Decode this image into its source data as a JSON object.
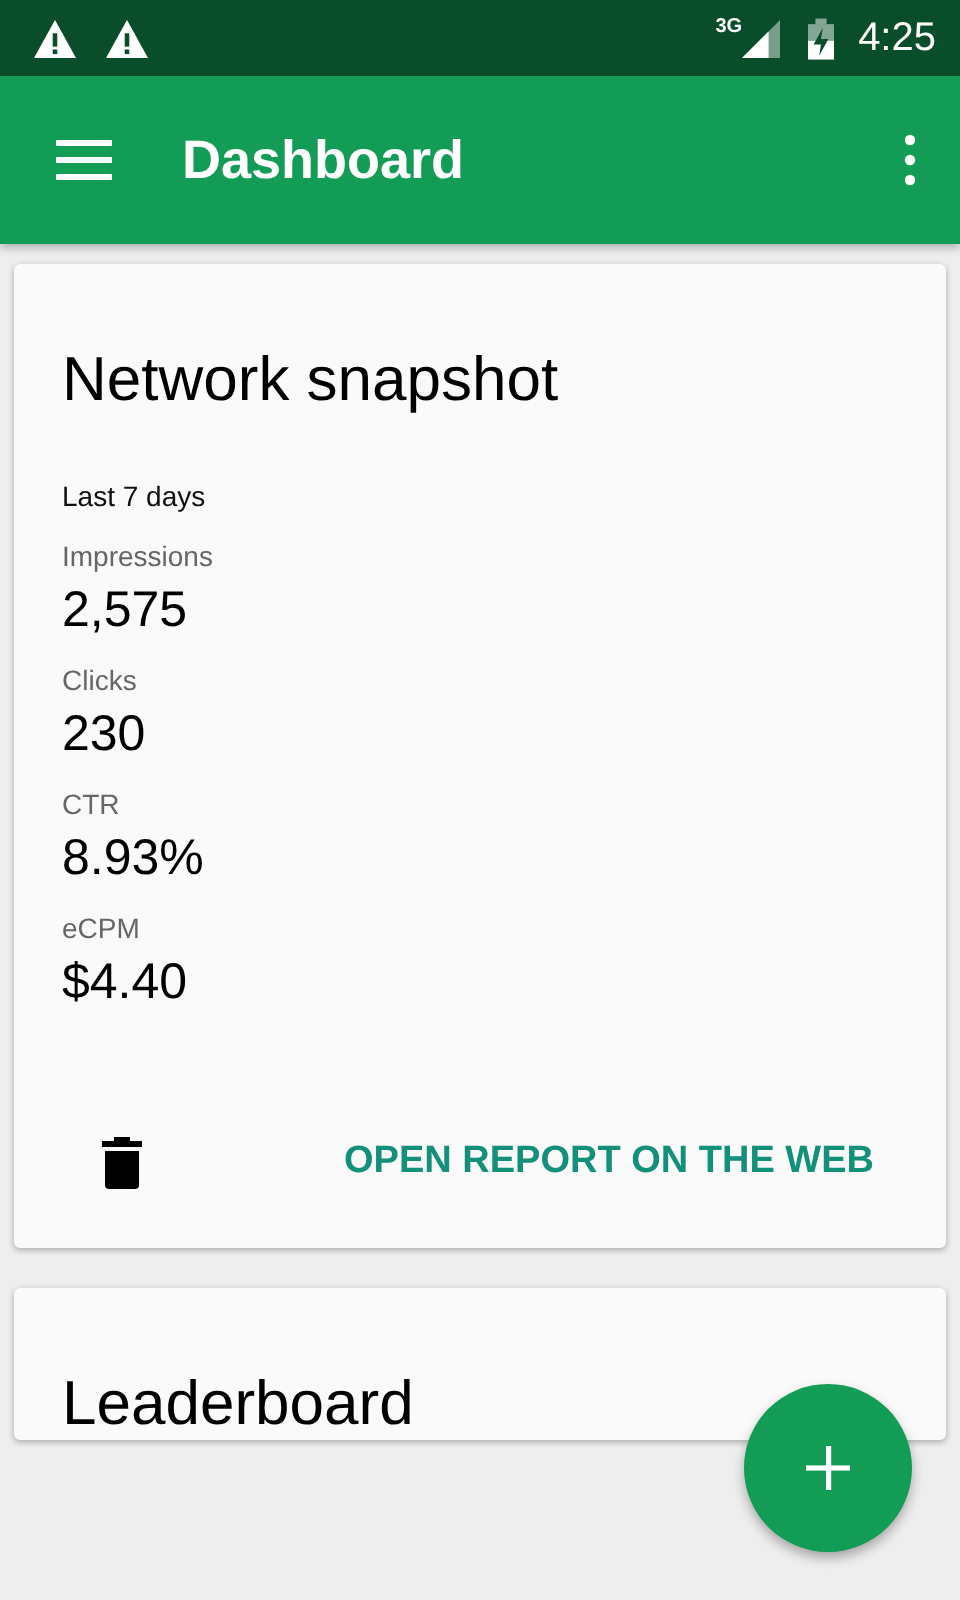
{
  "status_bar": {
    "network": "3G",
    "time": "4:25"
  },
  "app_bar": {
    "title": "Dashboard"
  },
  "cards": [
    {
      "title": "Network snapshot",
      "period": "Last 7 days",
      "metrics": [
        {
          "label": "Impressions",
          "value": "2,575"
        },
        {
          "label": "Clicks",
          "value": "230"
        },
        {
          "label": "CTR",
          "value": "8.93%"
        },
        {
          "label": "eCPM",
          "value": "$4.40"
        }
      ],
      "action": "OPEN REPORT ON THE WEB"
    },
    {
      "title": "Leaderboard"
    }
  ]
}
